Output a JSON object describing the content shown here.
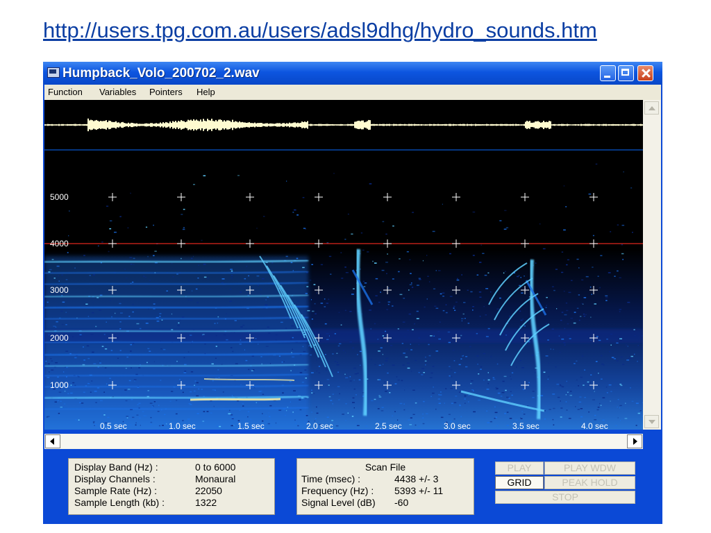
{
  "url": "http://users.tpg.com.au/users/adsl9dhg/hydro_sounds.htm",
  "window": {
    "title": "Humpback_Volo_200702_2.wav"
  },
  "menu": [
    "Function",
    "Variables",
    "Pointers",
    "Help"
  ],
  "spectrogram": {
    "freq_labels": [
      "5000",
      "4000",
      "3000",
      "2000",
      "1000"
    ],
    "time_labels": [
      "0.5 sec",
      "1.0 sec",
      "1.5 sec",
      "2.0 sec",
      "2.5 sec",
      "3.0 sec",
      "3.5 sec",
      "4.0 sec"
    ],
    "colors": {
      "trace": "#fffbd0",
      "trace_line": "#0a6cff",
      "pointer_line": "#e0261c",
      "grid": "#ffffff",
      "low": "#0a2a88",
      "mid": "#1a6fe6",
      "high": "#5fd0ff",
      "peak": "#fff6a8"
    }
  },
  "display_panel": {
    "rows": [
      {
        "label": "Display Band (Hz) :",
        "value": "0 to 6000"
      },
      {
        "label": "Display Channels :",
        "value": "Monaural"
      },
      {
        "label": "Sample Rate (Hz) :",
        "value": "22050"
      },
      {
        "label": "Sample Length (kb) :",
        "value": "1322"
      }
    ]
  },
  "scan_panel": {
    "title": "Scan File",
    "rows": [
      {
        "label": "Time (msec) :",
        "value": "4438 +/- 3"
      },
      {
        "label": "Frequency (Hz) :",
        "value": "5393 +/- 11"
      },
      {
        "label": "Signal Level (dB)",
        "value": "-60"
      }
    ]
  },
  "controls": {
    "play": "PLAY",
    "play_wdw": "PLAY WDW",
    "grid": "GRID",
    "peak_hold": "PEAK HOLD",
    "stop": "STOP"
  }
}
